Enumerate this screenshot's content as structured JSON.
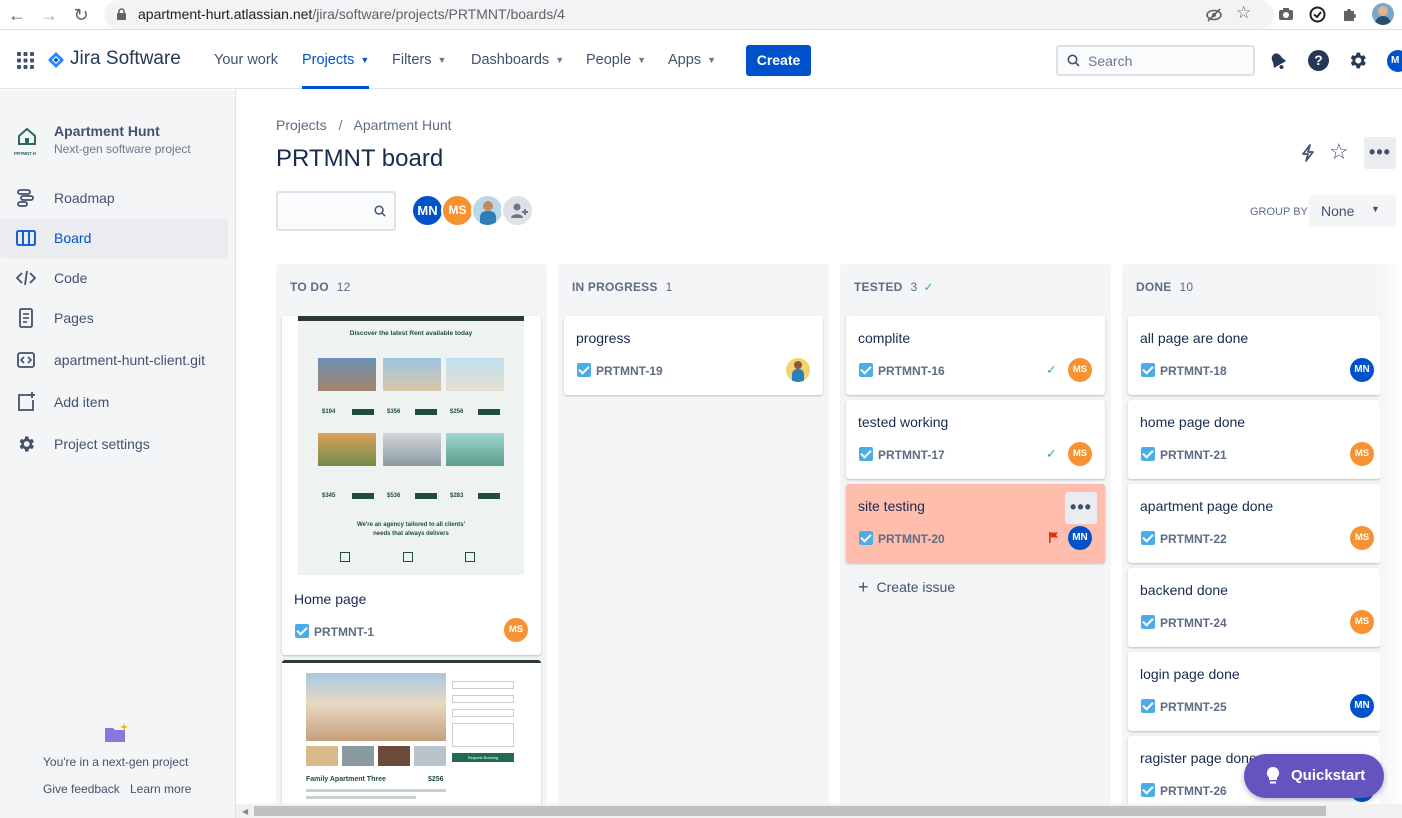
{
  "browser": {
    "url_host": "apartment-hurt.atlassian.net",
    "url_path": "/jira/software/projects/PRTMNT/boards/4"
  },
  "topnav": {
    "product": "Jira Software",
    "items": [
      {
        "label": "Your work",
        "dropdown": false
      },
      {
        "label": "Projects",
        "dropdown": true,
        "active": true
      },
      {
        "label": "Filters",
        "dropdown": true
      },
      {
        "label": "Dashboards",
        "dropdown": true
      },
      {
        "label": "People",
        "dropdown": true
      },
      {
        "label": "Apps",
        "dropdown": true
      }
    ],
    "create_label": "Create",
    "search_placeholder": "Search",
    "profile_initials": "M"
  },
  "sidebar": {
    "project_name": "Apartment Hunt",
    "project_type": "Next-gen software project",
    "project_logo_text": "PRTMNT H",
    "items": [
      {
        "label": "Roadmap",
        "icon": "roadmap-icon"
      },
      {
        "label": "Board",
        "icon": "board-icon",
        "active": true
      },
      {
        "label": "Code",
        "icon": "code-icon"
      },
      {
        "label": "Pages",
        "icon": "pages-icon"
      },
      {
        "label": "apartment-hunt-client.git",
        "icon": "repo-icon"
      },
      {
        "label": "Add item",
        "icon": "add-item-icon"
      },
      {
        "label": "Project settings",
        "icon": "gear-icon"
      }
    ],
    "footer_text": "You're in a next-gen project",
    "feedback_label": "Give feedback",
    "learn_label": "Learn more"
  },
  "board": {
    "breadcrumb": [
      "Projects",
      "Apartment Hunt"
    ],
    "breadcrumb_sep": "/",
    "title": "PRTMNT board",
    "group_by_label": "GROUP BY",
    "group_by_value": "None",
    "avatars": [
      "MN",
      "MS"
    ],
    "create_issue_label": "Create issue",
    "quickstart_label": "Quickstart",
    "columns": [
      {
        "name": "TO DO",
        "count": "12",
        "cards": [
          {
            "title": "Home page",
            "key": "PRTMNT-1",
            "assignee": "MS",
            "preview": {
              "heading": "Discover the latest Rent available today",
              "prices": [
                "$194",
                "$356",
                "$256",
                "$345",
                "$536",
                "$283"
              ],
              "tagline": "We're an agency tailored to all clients' needs that always delivers"
            }
          },
          {
            "title": "",
            "key": "",
            "assignee": "",
            "preview": {
              "heading": "Family Apartment Three",
              "price": "$256",
              "form_button": "Request Booking"
            }
          }
        ]
      },
      {
        "name": "IN PROGRESS",
        "count": "1",
        "cards": [
          {
            "title": "progress",
            "key": "PRTMNT-19",
            "assignee": "photo"
          }
        ]
      },
      {
        "name": "TESTED",
        "count": "3",
        "cards": [
          {
            "title": "complite",
            "key": "PRTMNT-16",
            "assignee": "MS",
            "done": true
          },
          {
            "title": "tested working",
            "key": "PRTMNT-17",
            "assignee": "MS",
            "done": true
          },
          {
            "title": "site testing",
            "key": "PRTMNT-20",
            "assignee": "MN",
            "flagged": true
          }
        ]
      },
      {
        "name": "DONE",
        "count": "10",
        "cards": [
          {
            "title": "all page are done",
            "key": "PRTMNT-18",
            "assignee": "MN"
          },
          {
            "title": "home page done",
            "key": "PRTMNT-21",
            "assignee": "MS"
          },
          {
            "title": "apartment page done",
            "key": "PRTMNT-22",
            "assignee": "MS"
          },
          {
            "title": "backend done",
            "key": "PRTMNT-24",
            "assignee": "MS"
          },
          {
            "title": "login page done",
            "key": "PRTMNT-25",
            "assignee": "MN"
          },
          {
            "title": "ragister page done",
            "key": "PRTMNT-26",
            "assignee": "MN"
          }
        ]
      }
    ]
  },
  "colors": {
    "brand": "#0052cc",
    "flagged_card": "#ffbdad",
    "done_check": "#36b37e",
    "ms_avatar": "#f79232",
    "quickstart": "#6554c0"
  }
}
